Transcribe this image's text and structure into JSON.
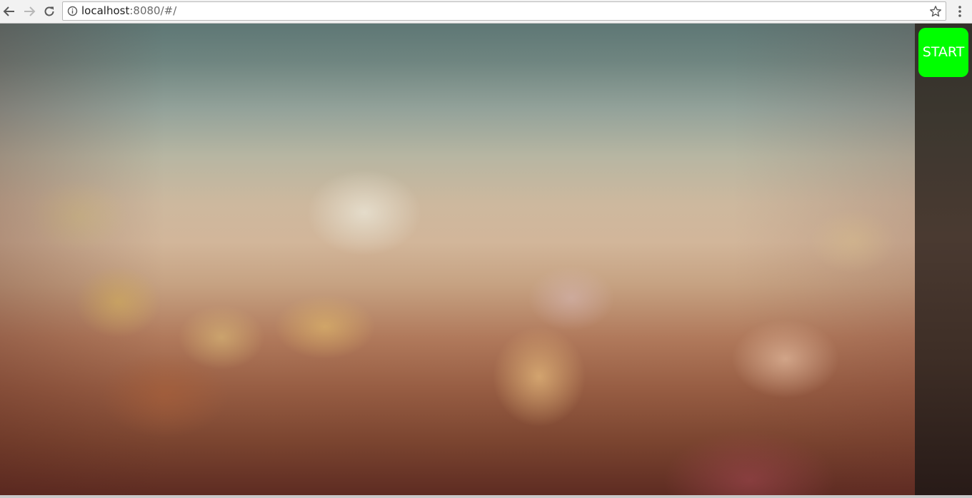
{
  "browser": {
    "url_host": "localhost",
    "url_rest": ":8080/#/",
    "icons": {
      "back": "back-arrow-icon",
      "forward": "forward-arrow-icon",
      "reload": "reload-icon",
      "info": "info-icon",
      "bookmark": "star-icon",
      "menu": "kebab-menu-icon"
    }
  },
  "sidebar": {
    "start_label": "START",
    "start_color": "#00ff00"
  }
}
